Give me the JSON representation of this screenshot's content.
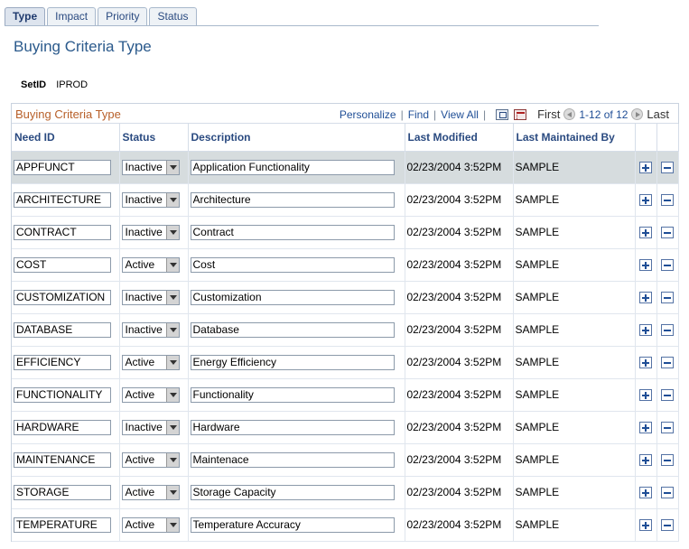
{
  "tabs": [
    "Type",
    "Impact",
    "Priority",
    "Status"
  ],
  "page_title": "Buying Criteria Type",
  "setid": {
    "label": "SetID",
    "value": "IPROD"
  },
  "grid": {
    "title": "Buying Criteria Type",
    "personalize": "Personalize",
    "find": "Find",
    "view_all": "View All",
    "first": "First",
    "range": "1-12 of 12",
    "last": "Last",
    "columns": [
      "Need ID",
      "Status",
      "Description",
      "Last Modified",
      "Last Maintained By"
    ],
    "rows": [
      {
        "need_id": "APPFUNCT",
        "status": "Inactive",
        "description": "Application Functionality",
        "modified": "02/23/2004  3:52PM",
        "by": "SAMPLE"
      },
      {
        "need_id": "ARCHITECTURE",
        "status": "Inactive",
        "description": "Architecture",
        "modified": "02/23/2004  3:52PM",
        "by": "SAMPLE"
      },
      {
        "need_id": "CONTRACT",
        "status": "Inactive",
        "description": "Contract",
        "modified": "02/23/2004  3:52PM",
        "by": "SAMPLE"
      },
      {
        "need_id": "COST",
        "status": "Active",
        "description": "Cost",
        "modified": "02/23/2004  3:52PM",
        "by": "SAMPLE"
      },
      {
        "need_id": "CUSTOMIZATION",
        "status": "Inactive",
        "description": "Customization",
        "modified": "02/23/2004  3:52PM",
        "by": "SAMPLE"
      },
      {
        "need_id": "DATABASE",
        "status": "Inactive",
        "description": "Database",
        "modified": "02/23/2004  3:52PM",
        "by": "SAMPLE"
      },
      {
        "need_id": "EFFICIENCY",
        "status": "Active",
        "description": "Energy Efficiency",
        "modified": "02/23/2004  3:52PM",
        "by": "SAMPLE"
      },
      {
        "need_id": "FUNCTIONALITY",
        "status": "Active",
        "description": "Functionality",
        "modified": "02/23/2004  3:52PM",
        "by": "SAMPLE"
      },
      {
        "need_id": "HARDWARE",
        "status": "Inactive",
        "description": "Hardware",
        "modified": "02/23/2004  3:52PM",
        "by": "SAMPLE"
      },
      {
        "need_id": "MAINTENANCE",
        "status": "Active",
        "description": "Maintenace",
        "modified": "02/23/2004  3:52PM",
        "by": "SAMPLE"
      },
      {
        "need_id": "STORAGE",
        "status": "Active",
        "description": "Storage Capacity",
        "modified": "02/23/2004  3:52PM",
        "by": "SAMPLE"
      },
      {
        "need_id": "TEMPERATURE",
        "status": "Active",
        "description": "Temperature Accuracy",
        "modified": "02/23/2004  3:52PM",
        "by": "SAMPLE"
      }
    ]
  },
  "icons": {
    "zoom": "zoom-grid-icon",
    "download": "download-to-excel-icon",
    "prev": "previous-arrow-icon",
    "next": "next-arrow-icon",
    "add_row": "add-row-icon",
    "delete_row": "delete-row-icon"
  },
  "colors": {
    "title_blue": "#2b5a8c",
    "grid_title_orange": "#b8602a",
    "header_blue": "#2a4a80",
    "link_blue": "#1f4e96",
    "selected_row": "#d6dcde"
  }
}
